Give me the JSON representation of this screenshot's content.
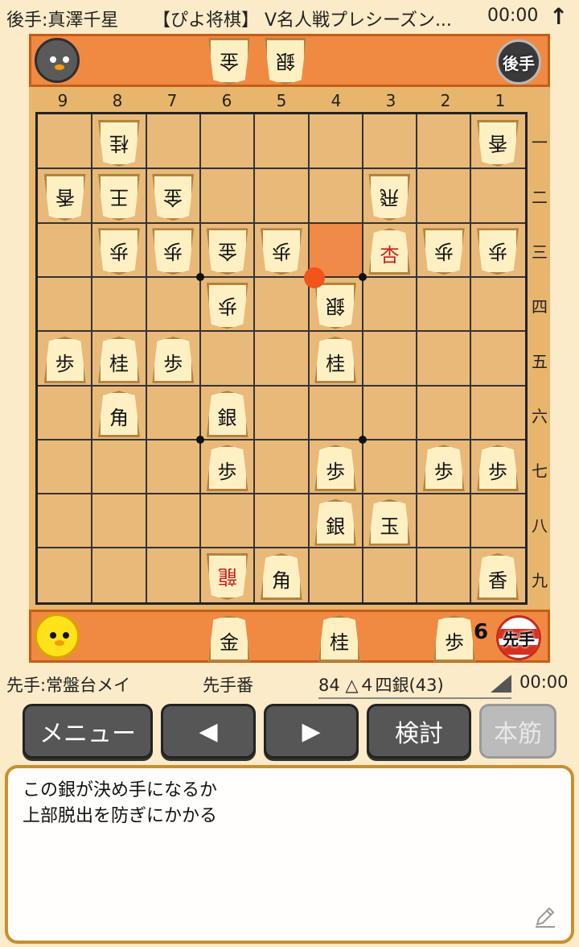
{
  "topbar": {
    "gote_player": "後手:真澤千星",
    "title": "【ぴよ将棋】 V名人戦プレシーズン...",
    "gote_clock": "00:00",
    "up_icon": "↑"
  },
  "gote_hand": {
    "badge": "後手",
    "pieces": [
      "金",
      "銀"
    ]
  },
  "sente_hand": {
    "badge": "先手",
    "pieces": [
      "金",
      "桂",
      "歩"
    ],
    "pawn_count": "6"
  },
  "board": {
    "file_labels": [
      "9",
      "8",
      "7",
      "6",
      "5",
      "4",
      "3",
      "2",
      "1"
    ],
    "rank_labels": [
      "一",
      "二",
      "三",
      "四",
      "五",
      "六",
      "七",
      "八",
      "九"
    ],
    "last_move_square": {
      "file": 4,
      "rank": 3
    },
    "pieces": [
      {
        "file": 8,
        "rank": 1,
        "label": "桂",
        "owner": "gote"
      },
      {
        "file": 1,
        "rank": 1,
        "label": "香",
        "owner": "gote"
      },
      {
        "file": 9,
        "rank": 2,
        "label": "香",
        "owner": "gote"
      },
      {
        "file": 8,
        "rank": 2,
        "label": "王",
        "owner": "gote"
      },
      {
        "file": 7,
        "rank": 2,
        "label": "金",
        "owner": "gote"
      },
      {
        "file": 3,
        "rank": 2,
        "label": "飛",
        "owner": "gote"
      },
      {
        "file": 8,
        "rank": 3,
        "label": "歩",
        "owner": "gote"
      },
      {
        "file": 7,
        "rank": 3,
        "label": "歩",
        "owner": "gote"
      },
      {
        "file": 6,
        "rank": 3,
        "label": "金",
        "owner": "gote"
      },
      {
        "file": 5,
        "rank": 3,
        "label": "歩",
        "owner": "gote"
      },
      {
        "file": 3,
        "rank": 3,
        "label": "杏",
        "owner": "sente",
        "promoted": true
      },
      {
        "file": 2,
        "rank": 3,
        "label": "歩",
        "owner": "gote"
      },
      {
        "file": 1,
        "rank": 3,
        "label": "歩",
        "owner": "gote"
      },
      {
        "file": 6,
        "rank": 4,
        "label": "歩",
        "owner": "gote"
      },
      {
        "file": 4,
        "rank": 4,
        "label": "銀",
        "owner": "gote"
      },
      {
        "file": 9,
        "rank": 5,
        "label": "歩",
        "owner": "sente"
      },
      {
        "file": 8,
        "rank": 5,
        "label": "桂",
        "owner": "sente"
      },
      {
        "file": 7,
        "rank": 5,
        "label": "歩",
        "owner": "sente"
      },
      {
        "file": 4,
        "rank": 5,
        "label": "桂",
        "owner": "sente"
      },
      {
        "file": 8,
        "rank": 6,
        "label": "角",
        "owner": "sente"
      },
      {
        "file": 6,
        "rank": 6,
        "label": "銀",
        "owner": "sente"
      },
      {
        "file": 6,
        "rank": 7,
        "label": "歩",
        "owner": "sente"
      },
      {
        "file": 4,
        "rank": 7,
        "label": "歩",
        "owner": "sente"
      },
      {
        "file": 2,
        "rank": 7,
        "label": "歩",
        "owner": "sente"
      },
      {
        "file": 1,
        "rank": 7,
        "label": "歩",
        "owner": "sente"
      },
      {
        "file": 4,
        "rank": 8,
        "label": "銀",
        "owner": "sente"
      },
      {
        "file": 3,
        "rank": 8,
        "label": "玉",
        "owner": "sente"
      },
      {
        "file": 6,
        "rank": 9,
        "label": "龍",
        "owner": "gote",
        "promoted": true
      },
      {
        "file": 5,
        "rank": 9,
        "label": "角",
        "owner": "sente"
      },
      {
        "file": 1,
        "rank": 9,
        "label": "香",
        "owner": "sente"
      }
    ]
  },
  "info": {
    "sente_player": "先手:常盤台メイ",
    "turn": "先手番",
    "move": "84 △４四銀(43)",
    "sente_clock": "00:00"
  },
  "buttons": {
    "menu": "メニュー",
    "back": "◀",
    "forward": "▶",
    "analyze": "検討",
    "mainline": "本筋"
  },
  "comment": {
    "line1": "この銀が決め手になるか",
    "line2": "上部脱出を防ぎにかかる"
  },
  "icons": {
    "pencil": "pencil-icon",
    "corner": "corner-triangle-icon"
  },
  "colors": {
    "hand_bar": "#f08a43",
    "highlight": "#ef8a48",
    "last_move_dot": "#f2541b",
    "promoted_text": "#c8201a"
  }
}
